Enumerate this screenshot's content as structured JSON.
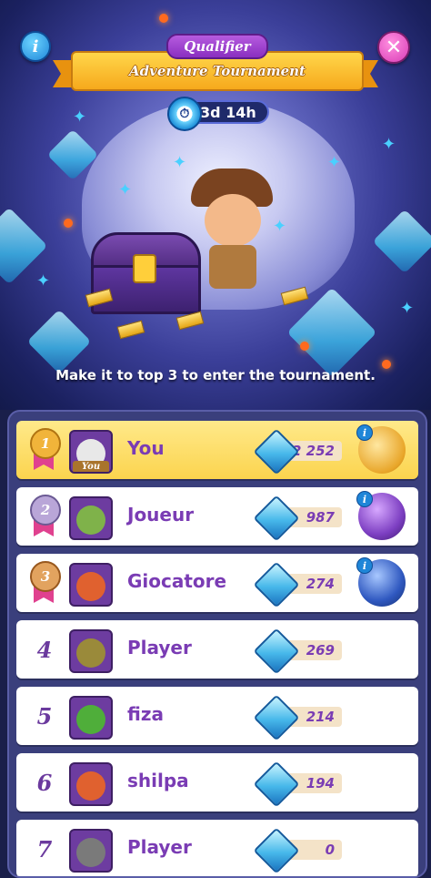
{
  "header": {
    "badge": "Qualifier",
    "title": "Adventure Tournament",
    "timer": "3d 14h",
    "tagline": "Make it to top 3 to enter the tournament."
  },
  "buttons": {
    "info": "i",
    "close": "✕",
    "reward_info": "i"
  },
  "leaderboard": [
    {
      "rank": "1",
      "name": "You",
      "score": "2 252",
      "is_me": true,
      "tag": "You",
      "medal": "gold",
      "reward": "gold-chest"
    },
    {
      "rank": "2",
      "name": "Joueur",
      "score": "987",
      "medal": "silver",
      "reward": "purple-orb"
    },
    {
      "rank": "3",
      "name": "Giocatore",
      "score": "274",
      "medal": "bronze",
      "reward": "blue-orb"
    },
    {
      "rank": "4",
      "name": "Player",
      "score": "269"
    },
    {
      "rank": "5",
      "name": "fiza",
      "score": "214"
    },
    {
      "rank": "6",
      "name": "shilpa",
      "score": "194"
    },
    {
      "rank": "7",
      "name": "Player",
      "score": "0"
    }
  ],
  "colors": {
    "accent": "#7a3cb4",
    "ribbon": "#f6a91c",
    "highlight_row": "#fbd44e"
  }
}
